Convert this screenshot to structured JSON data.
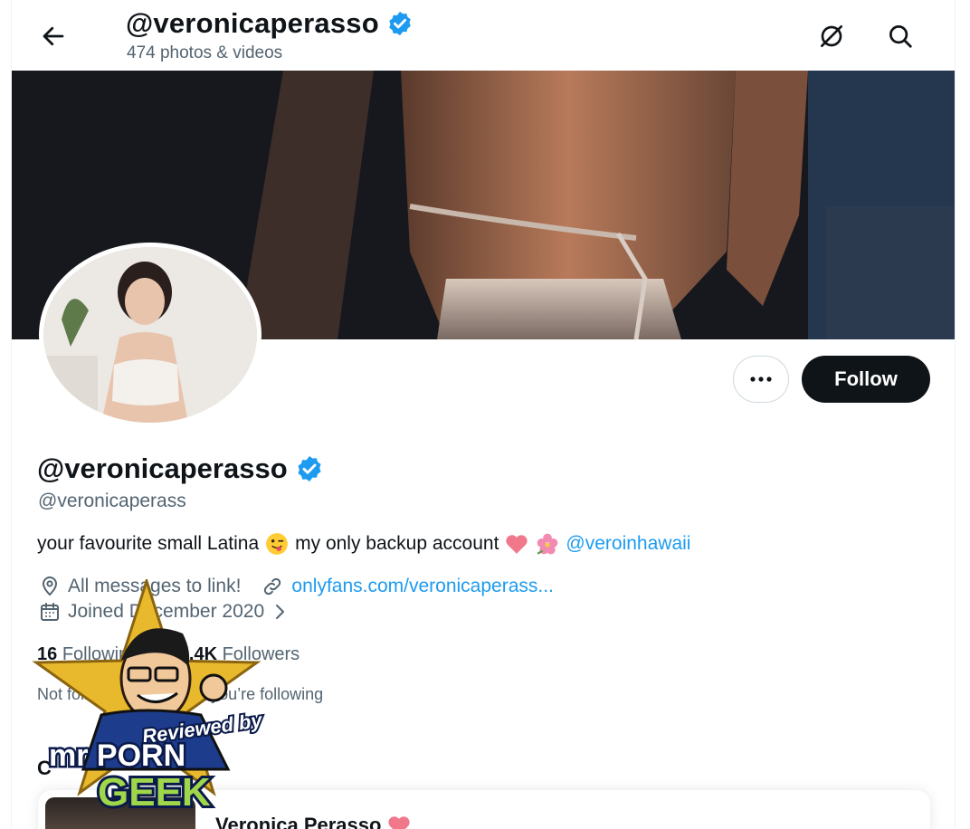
{
  "header": {
    "title": "@veronicaperasso",
    "subtitle": "474 photos & videos"
  },
  "profile": {
    "display_name": "@veronicaperasso",
    "handle": "@veronicaperass",
    "bio_text": "your favourite small Latina",
    "bio_text_2": "my only backup account",
    "bio_link": "@veroinhawaii",
    "location": "All messages to link!",
    "website": "onlyfans.com/veronicaperass...",
    "joined": "Joined December 2020",
    "following_count": "16",
    "following_label": "Following",
    "followers_count": "296.4K",
    "followers_label": "Followers",
    "followed_by": "Not followed by anyone you’re following"
  },
  "actions": {
    "follow_label": "Follow"
  },
  "section": {
    "letter": "C"
  },
  "card": {
    "name": "Veronica Perasso"
  },
  "watermark": {
    "line1": "Reviewed by",
    "line2": "mr PORN",
    "line3": "GEEK"
  },
  "colors": {
    "accent": "#1d9bf0",
    "text": "#0f1419",
    "muted": "#536471",
    "follow_bg": "#0f1419"
  },
  "icons": {
    "back": "arrow-left-icon",
    "no_notifications": "slash-circle-icon",
    "search": "search-icon",
    "verified": "verified-badge-icon",
    "more": "more-dots-icon",
    "location": "location-pin-icon",
    "link": "link-icon",
    "calendar": "calendar-icon",
    "chevron": "chevron-right-icon"
  }
}
